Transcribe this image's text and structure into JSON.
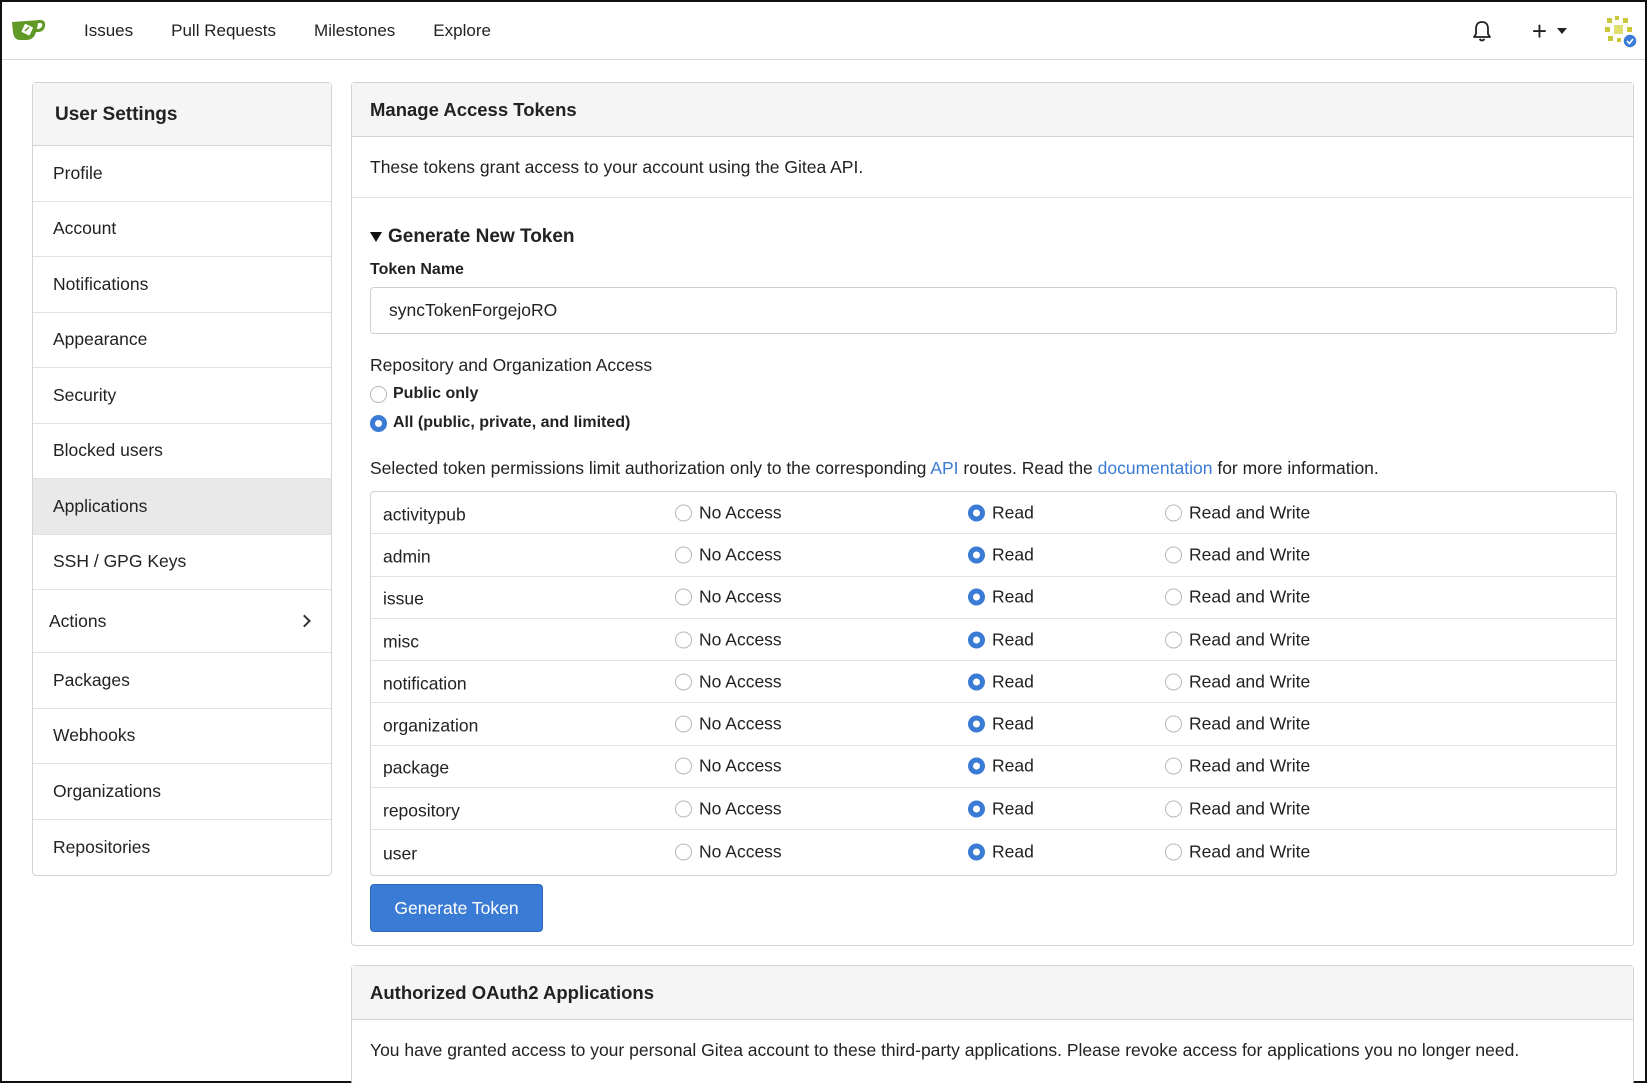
{
  "nav": {
    "links": [
      "Issues",
      "Pull Requests",
      "Milestones",
      "Explore"
    ],
    "plus": "+"
  },
  "sidebar": {
    "header": "User Settings",
    "items": [
      {
        "label": "Profile"
      },
      {
        "label": "Account"
      },
      {
        "label": "Notifications"
      },
      {
        "label": "Appearance"
      },
      {
        "label": "Security"
      },
      {
        "label": "Blocked users"
      },
      {
        "label": "Applications"
      },
      {
        "label": "SSH / GPG Keys"
      },
      {
        "label": "Actions"
      },
      {
        "label": "Packages"
      },
      {
        "label": "Webhooks"
      },
      {
        "label": "Organizations"
      },
      {
        "label": "Repositories"
      }
    ],
    "active": "Applications"
  },
  "tokens": {
    "title": "Manage Access Tokens",
    "description": "These tokens grant access to your account using the Gitea API.",
    "generate_title": "Generate New Token",
    "token_name_label": "Token Name",
    "token_name_value": "syncTokenForgejoRO",
    "access_label": "Repository and Organization Access",
    "access_options": [
      "Public only",
      "All (public, private, and limited)"
    ],
    "access_selected": "All (public, private, and limited)",
    "perm_note_prefix": "Selected token permissions limit authorization only to the corresponding ",
    "perm_note_api": "API",
    "perm_note_mid": " routes. Read the ",
    "perm_note_doc": "documentation",
    "perm_note_suffix": " for more information.",
    "option_labels": [
      "No Access",
      "Read",
      "Read and Write"
    ],
    "permissions": [
      {
        "name": "activitypub",
        "selected": "Read"
      },
      {
        "name": "admin",
        "selected": "Read"
      },
      {
        "name": "issue",
        "selected": "Read"
      },
      {
        "name": "misc",
        "selected": "Read"
      },
      {
        "name": "notification",
        "selected": "Read"
      },
      {
        "name": "organization",
        "selected": "Read"
      },
      {
        "name": "package",
        "selected": "Read"
      },
      {
        "name": "repository",
        "selected": "Read"
      },
      {
        "name": "user",
        "selected": "Read"
      }
    ],
    "generate_button": "Generate Token"
  },
  "oauth": {
    "title": "Authorized OAuth2 Applications",
    "description": "You have granted access to your personal Gitea account to these third-party applications. Please revoke access for applications you no longer need."
  },
  "colors": {
    "accent": "#3a7bd5",
    "logo_green": "#609926"
  }
}
